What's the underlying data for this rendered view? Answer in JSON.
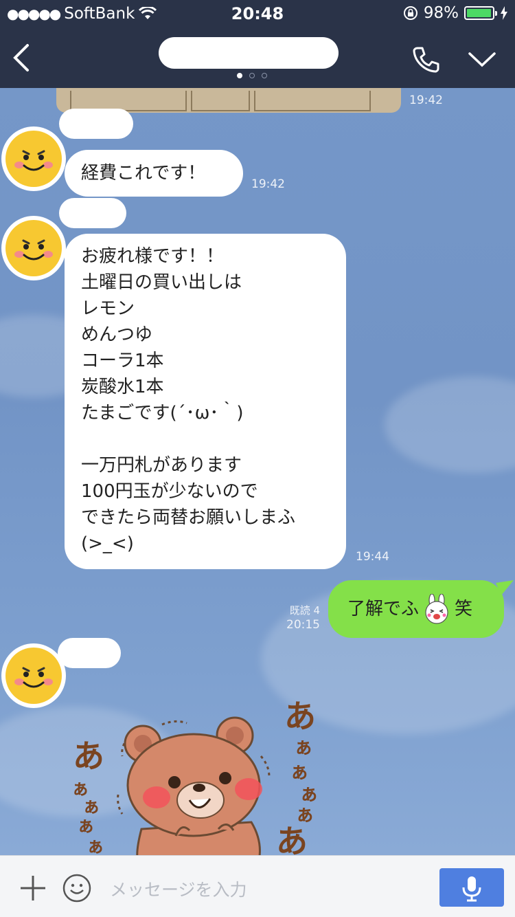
{
  "status_bar": {
    "signal_dots": "●●●●●",
    "carrier": "SoftBank",
    "time": "20:48",
    "battery_percent_text": "98%",
    "battery_level": 0.98,
    "accent_color": "#4cd964"
  },
  "nav": {
    "back_icon": "chevron-left-icon",
    "call_icon": "phone-icon",
    "menu_icon": "chevron-down-icon",
    "page_count": 3,
    "active_page": 1
  },
  "messages": {
    "image_time": "19:42",
    "m1": {
      "text": "経費これです！",
      "time": "19:42"
    },
    "m2": {
      "lines": [
        "お疲れ様です！！",
        "土曜日の買い出しは",
        "レモン",
        "めんつゆ",
        "コーラ1本",
        "炭酸水1本",
        "たまごです(´･ω･｀)",
        "",
        "一万円札があります",
        "100円玉が少ないので",
        "できたら両替お願いしまふ",
        "(>_<)"
      ],
      "time": "19:44"
    },
    "m3": {
      "text_before": "了解でふ",
      "text_after": "笑",
      "emoji": "bunny-emoji-icon",
      "read": "既読 4",
      "time": "20:15",
      "color": "#84e049"
    },
    "sticker": {
      "text_left": "あ",
      "text_right": "あ",
      "icon": "bear-sticker-icon"
    }
  },
  "input": {
    "placeholder": "メッセージを入力",
    "mic_color": "#4f7fe0"
  }
}
